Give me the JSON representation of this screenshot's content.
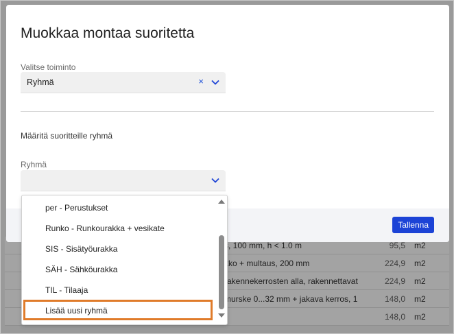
{
  "background_table": {
    "rows": [
      {
        "desc": "s, 100 mm, h < 1.0 m",
        "qty": "95,5",
        "unit": "m2"
      },
      {
        "desc": "kko + multaus, 200 mm",
        "qty": "224,9",
        "unit": "m2"
      },
      {
        "desc": "rakennekerrosten alla, rakennettavat",
        "qty": "224,9",
        "unit": "m2"
      },
      {
        "desc": "murske 0...32 mm + jakava kerros, 1",
        "qty": "148,0",
        "unit": "m2"
      },
      {
        "desc": "",
        "qty": "148,0",
        "unit": "m2"
      }
    ]
  },
  "modal": {
    "title": "Muokkaa montaa suoritetta",
    "action_field": {
      "label": "Valitse toiminto",
      "value": "Ryhmä",
      "clear_symbol": "×"
    },
    "section_text": "Määritä suoritteille ryhmä",
    "group_field": {
      "label": "Ryhmä",
      "value": ""
    },
    "save_label": "Tallenna"
  },
  "dropdown": {
    "options": [
      {
        "label": "per - Perustukset"
      },
      {
        "label": "Runko - Runkourakka + vesikate"
      },
      {
        "label": "SIS - Sisätyöurakka"
      },
      {
        "label": "SÄH - Sähköurakka"
      },
      {
        "label": "TIL - Tilaaja"
      },
      {
        "label": "Lisää uusi ryhmä"
      }
    ],
    "highlighted_index": 5
  },
  "colors": {
    "accent": "#1c43d6",
    "highlight_outline": "#e07b2a"
  }
}
